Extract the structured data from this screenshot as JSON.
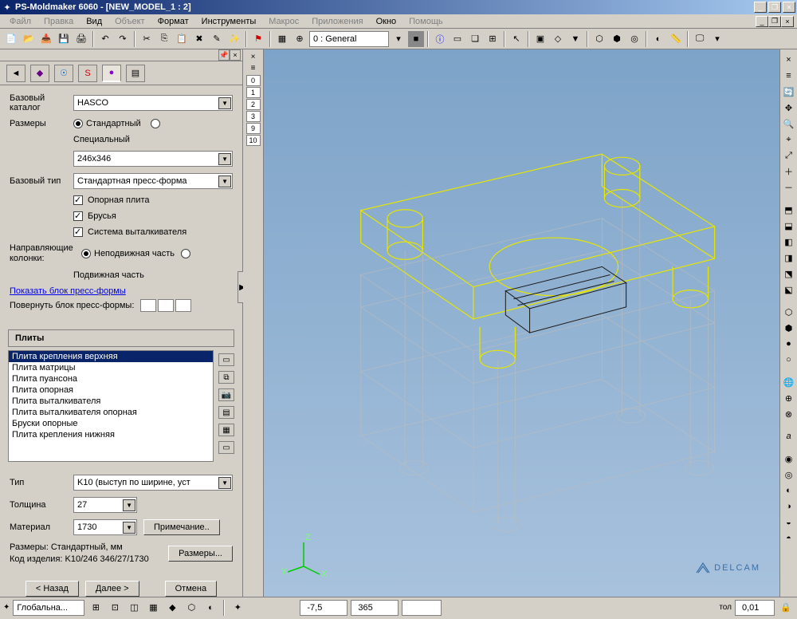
{
  "title": "PS-Moldmaker 6060 - [NEW_MODEL_1 : 2]",
  "menubar": [
    "Файл",
    "Правка",
    "Вид",
    "Объект",
    "Формат",
    "Инструменты",
    "Макрос",
    "Приложения",
    "Окно",
    "Помощь"
  ],
  "toolbar_combo": "0  : General",
  "ruler_levels": [
    "0",
    "1",
    "2",
    "3",
    "9",
    "10"
  ],
  "form": {
    "catalog_label": "Базовый каталог",
    "catalog_value": "HASCO",
    "sizes_label": "Размеры",
    "radio_standard": "Стандартный",
    "radio_special": "Специальный",
    "size_value": "246x346",
    "base_type_label": "Базовый тип",
    "base_type_value": "Стандартная пресс-форма",
    "cb_baseplate": "Опорная плита",
    "cb_bars": "Брусья",
    "cb_ejector": "Система выталкивателя",
    "guide_label": "Направляющие колонки:",
    "radio_fixed": "Неподвижная часть",
    "radio_moving": "Подвижная часть",
    "show_link": "Показать блок пресс-формы",
    "rotate_label": "Повернуть блок пресс-формы:"
  },
  "plates_header": "Плиты",
  "plates": [
    "Плита крепления верхняя",
    "Плита матрицы",
    "Плита пуансона",
    "Плита опорная",
    "Плита выталкивателя",
    "Плита выталкивателя опорная",
    "Бруски опорные",
    "Плита крепления нижняя"
  ],
  "detail": {
    "type_label": "Тип",
    "type_value": "K10 (выступ по ширине, уст",
    "thickness_label": "Толщина",
    "thickness_value": "27",
    "material_label": "Материал",
    "material_value": "1730",
    "note_btn": "Примечание..",
    "dims_label": "Размеры:",
    "dims_value": "Стандартный, мм",
    "code_label": "Код изделия:",
    "code_value": "K10/246 346/27/1730",
    "dims_btn": "Размеры..."
  },
  "nav": {
    "back": "< Назад",
    "next": "Далее >",
    "cancel": "Отмена"
  },
  "status": {
    "cs": "Глобальна...",
    "x": "-7,5",
    "y": "365",
    "tol_label": "тол",
    "tol": "0,01"
  },
  "logo": "DELCAM",
  "axis": {
    "x": "X",
    "y": "Y",
    "z": "Z"
  }
}
